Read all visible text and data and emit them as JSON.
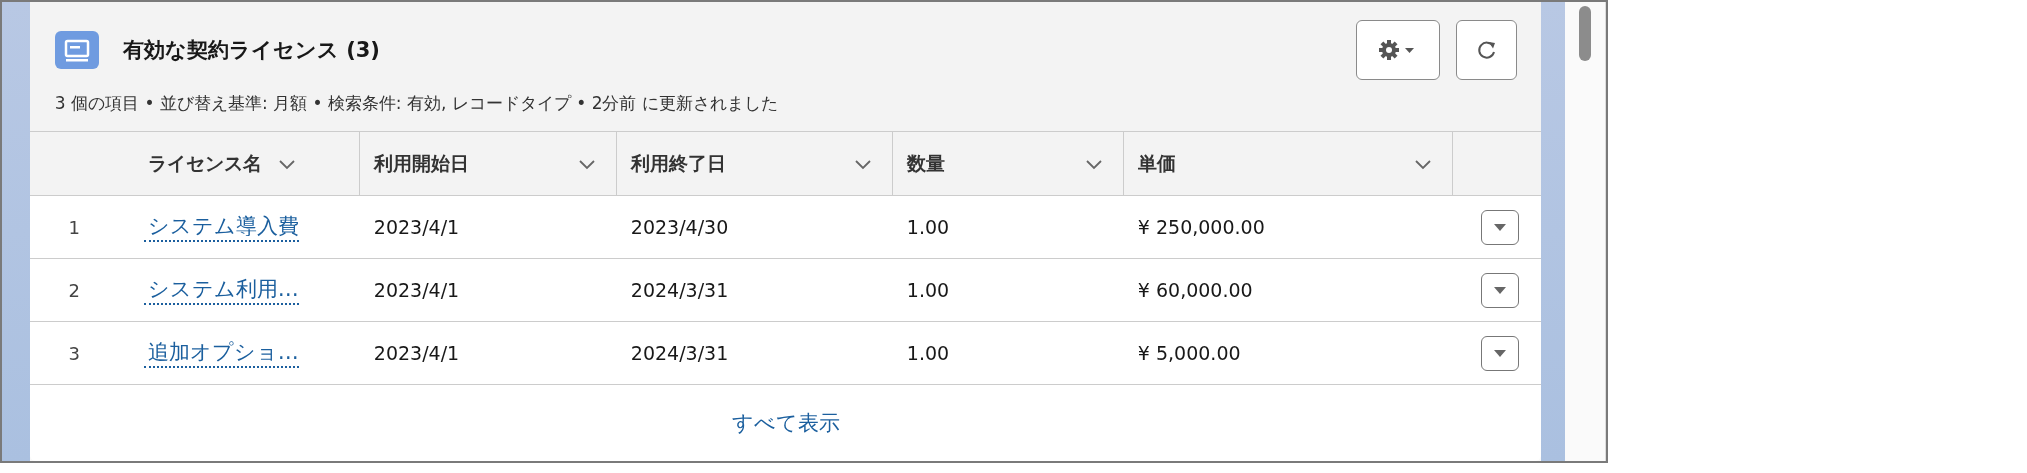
{
  "card": {
    "title": "有効な契約ライセンス (3)",
    "subtitle": "3 個の項目 • 並び替え基準: 月額 • 検索条件: 有効, レコードタイプ • 2分前 に更新されました"
  },
  "table": {
    "columns": [
      "ライセンス名",
      "利用開始日",
      "利用終了日",
      "数量",
      "単価"
    ],
    "rows": [
      {
        "number": "1",
        "name": "システム導入費",
        "start": "2023/4/1",
        "end": "2023/4/30",
        "quantity": "1.00",
        "price": "¥ 250,000.00"
      },
      {
        "number": "2",
        "name": "システム利用…",
        "start": "2023/4/1",
        "end": "2024/3/31",
        "quantity": "1.00",
        "price": "¥ 60,000.00"
      },
      {
        "number": "3",
        "name": "追加オプショ…",
        "start": "2023/4/1",
        "end": "2024/3/31",
        "quantity": "1.00",
        "price": "¥ 5,000.00"
      }
    ]
  },
  "footer": {
    "link": "すべて表示"
  }
}
